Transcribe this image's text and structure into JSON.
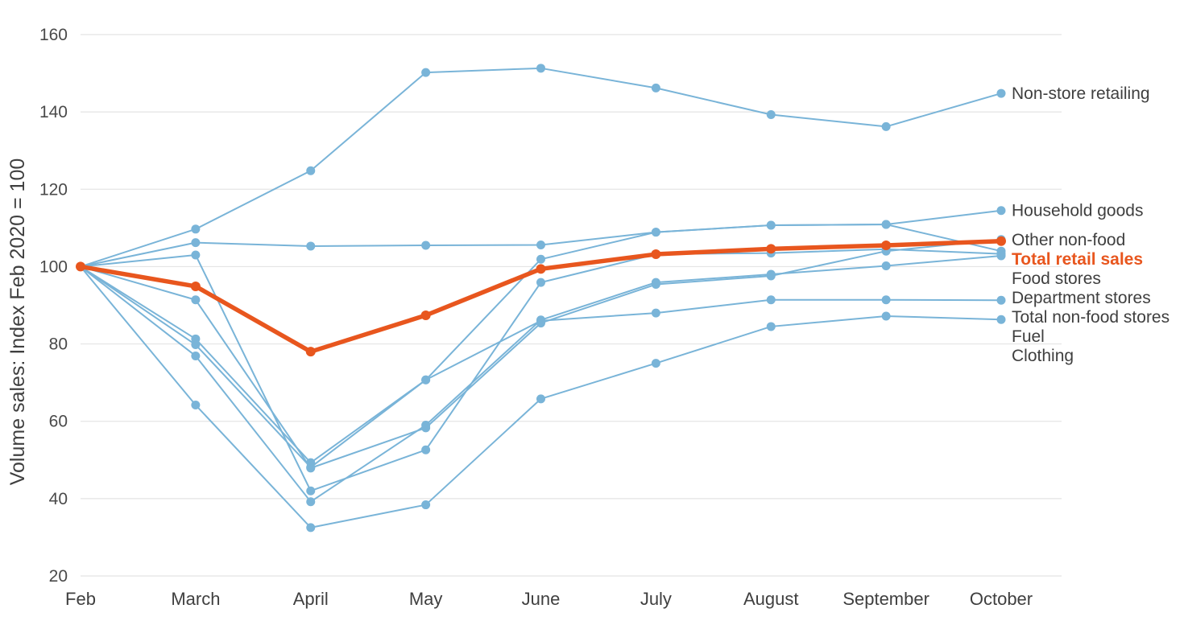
{
  "chart_data": {
    "type": "line",
    "title": "",
    "xlabel": "",
    "ylabel": "Volume sales: Index Feb 2020 = 100",
    "categories": [
      "Feb",
      "March",
      "April",
      "May",
      "June",
      "July",
      "August",
      "September",
      "October"
    ],
    "x": [
      "Feb",
      "March",
      "April",
      "May",
      "June",
      "July",
      "August",
      "September",
      "October"
    ],
    "ylim": [
      20,
      160
    ],
    "yticks": [
      20,
      40,
      60,
      80,
      100,
      120,
      140,
      160
    ],
    "grid": true,
    "legend_position": "right-of-plot-line-end-labels",
    "colors": {
      "default_series": "#79b4d8",
      "highlight_series": "#e8561e",
      "gridline": "#e4e4e4",
      "text": "#3f3f3f",
      "background": "#ffffff"
    },
    "series": [
      {
        "name": "Non-store retailing",
        "color": "#79b4d8",
        "highlight": false,
        "values": [
          100,
          109.7,
          124.8,
          150.2,
          151.3,
          146.2,
          139.3,
          136.2,
          144.8
        ]
      },
      {
        "name": "Household goods",
        "color": "#79b4d8",
        "highlight": false,
        "values": [
          100,
          81.3,
          49.3,
          70.7,
          101.9,
          108.9,
          110.7,
          110.9,
          114.5
        ]
      },
      {
        "name": "Other non-food",
        "color": "#79b4d8",
        "highlight": false,
        "values": [
          100,
          91.4,
          47.9,
          58.3,
          85.4,
          95.4,
          97.6,
          104.0,
          107.0
        ]
      },
      {
        "name": "Total retail sales",
        "color": "#e8561e",
        "highlight": true,
        "values": [
          100,
          94.9,
          78.0,
          87.4,
          99.4,
          103.2,
          104.6,
          105.5,
          106.6
        ]
      },
      {
        "name": "Food stores",
        "color": "#79b4d8",
        "highlight": false,
        "values": [
          100,
          106.2,
          105.3,
          105.5,
          105.6,
          108.9,
          110.7,
          110.9,
          104.0
        ]
      },
      {
        "name": "Department stores",
        "color": "#79b4d8",
        "highlight": false,
        "values": [
          100,
          103.0,
          42.0,
          52.6,
          95.9,
          103.2,
          103.5,
          104.5,
          103.3
        ]
      },
      {
        "name": "Total non-food stores",
        "color": "#79b4d8",
        "highlight": false,
        "values": [
          100,
          76.9,
          39.2,
          59.0,
          86.2,
          95.9,
          98.0,
          100.2,
          102.8
        ]
      },
      {
        "name": "Fuel",
        "color": "#79b4d8",
        "highlight": false,
        "values": [
          100,
          79.8,
          48.1,
          70.7,
          86.0,
          88.0,
          91.4,
          91.4,
          91.3
        ]
      },
      {
        "name": "Clothing",
        "color": "#79b4d8",
        "highlight": false,
        "values": [
          100,
          64.2,
          32.5,
          38.4,
          65.8,
          75.0,
          84.5,
          87.2,
          86.3
        ]
      }
    ],
    "end_labels": [
      {
        "name": "Non-store retailing",
        "value": 144.8,
        "highlight": false
      },
      {
        "name": "Household goods",
        "value": 114.5,
        "highlight": false
      },
      {
        "name": "Other non-food",
        "value": 107.0,
        "highlight": false
      },
      {
        "name": "Total retail sales",
        "value": 106.6,
        "highlight": true
      },
      {
        "name": "Food stores",
        "value": 104.0,
        "highlight": false
      },
      {
        "name": "Department stores",
        "value": 103.3,
        "highlight": false
      },
      {
        "name": "Total non-food stores",
        "value": 102.8,
        "highlight": false
      },
      {
        "name": "Fuel",
        "value": 91.3,
        "highlight": false
      },
      {
        "name": "Clothing",
        "value": 86.3,
        "highlight": false
      }
    ]
  }
}
